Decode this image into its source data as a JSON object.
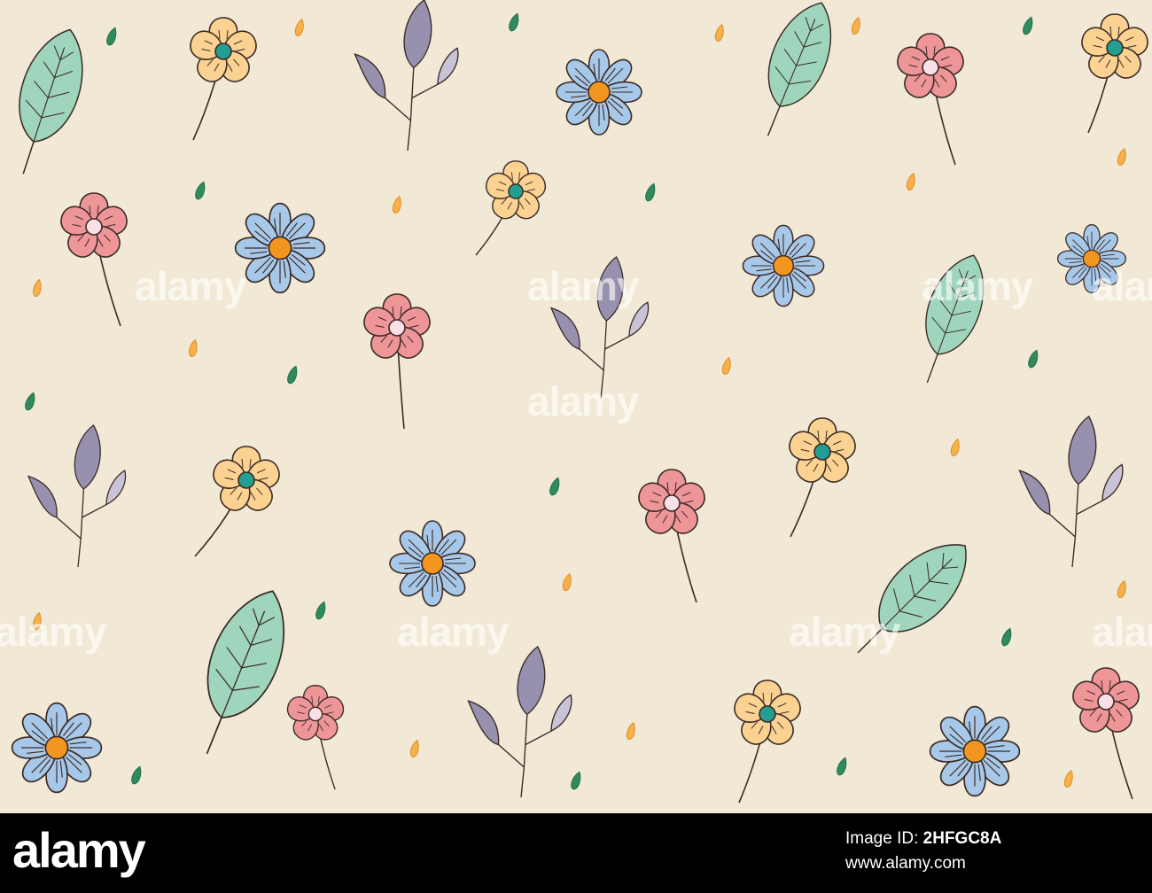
{
  "image": {
    "background_color": "#f1e9d6",
    "outline_color": "#3a2a26",
    "palette": {
      "blue_petal": "#a7c8e8",
      "blue_center": "#f29620",
      "pink_petal": "#ee9598",
      "pink_center": "#f9dfe6",
      "yellow_petal": "#fbd291",
      "yellow_center": "#249e93",
      "green_leaf": "#9fd5bc",
      "purple_leaf": "#9890af",
      "lavender_leaf": "#c9c3d7",
      "orange_drop": "#f7b04a",
      "green_drop": "#2f8b5d"
    },
    "motifs": [
      "blue daisy",
      "pink flower",
      "yellow flower",
      "green leaf",
      "purple leaf sprig",
      "orange drop",
      "green drop"
    ]
  },
  "watermark": {
    "text": "alamy",
    "repeat_count": 9
  },
  "footer": {
    "logo": "alamy",
    "id_label": "Image ID: ",
    "id_value": "2HFGC8A",
    "url": "www.alamy.com"
  }
}
